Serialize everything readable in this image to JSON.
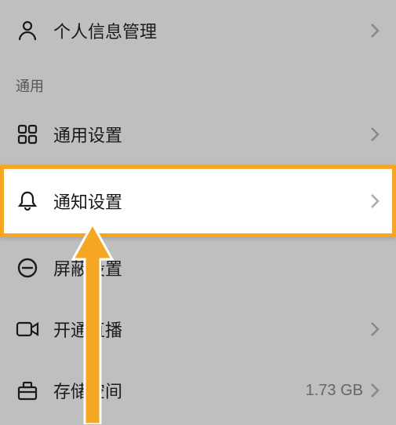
{
  "items": {
    "personal_info": {
      "label": "个人信息管理"
    },
    "general_settings": {
      "label": "通用设置"
    },
    "notification_settings": {
      "label": "通知设置"
    },
    "screen_settings": {
      "label": "屏蔽设置"
    },
    "live_streaming": {
      "label": "开通直播"
    },
    "storage": {
      "label": "存储空间",
      "value": "1.73 GB"
    }
  },
  "sections": {
    "general": "通用"
  }
}
